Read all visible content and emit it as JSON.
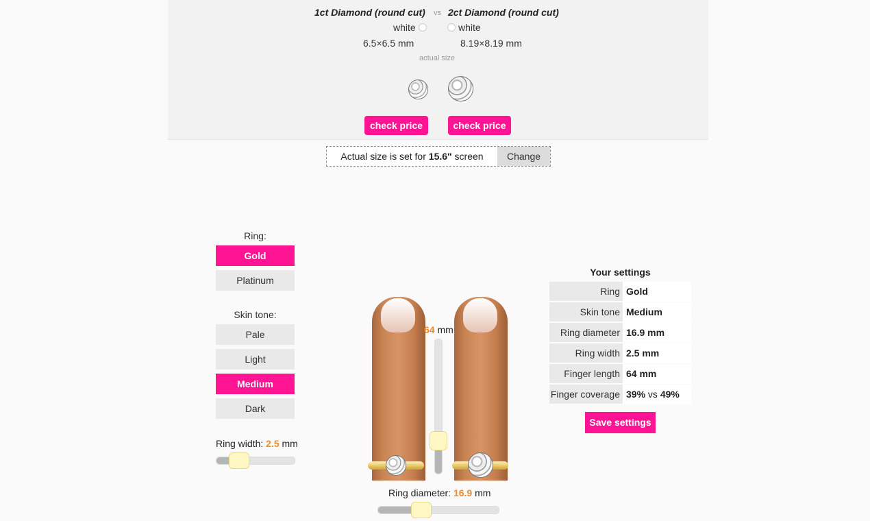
{
  "comparison": {
    "left": {
      "title": "1ct Diamond (round cut)",
      "color": "white",
      "size": "6.5×6.5 mm",
      "button": "check price"
    },
    "vs": "vs",
    "right": {
      "title": "2ct Diamond (round cut)",
      "color": "white",
      "size": "8.19×8.19 mm",
      "button": "check price"
    },
    "actual_size_note": "actual size"
  },
  "screen": {
    "prefix": "Actual size is set for ",
    "size": "15.6\"",
    "suffix": " screen",
    "change": "Change"
  },
  "ring": {
    "label": "Ring:",
    "options": [
      {
        "label": "Gold",
        "active": true
      },
      {
        "label": "Platinum",
        "active": false
      }
    ]
  },
  "skin": {
    "label": "Skin tone:",
    "options": [
      {
        "label": "Pale",
        "active": false
      },
      {
        "label": "Light",
        "active": false
      },
      {
        "label": "Medium",
        "active": true
      },
      {
        "label": "Dark",
        "active": false
      }
    ]
  },
  "ring_width": {
    "label": "Ring width: ",
    "value": "2.5",
    "unit": " mm",
    "fraction": 0.28
  },
  "finger_length": {
    "value": "64",
    "unit": " mm",
    "fraction": 0.25
  },
  "ring_diameter": {
    "label": "Ring diameter: ",
    "value": "16.9",
    "unit": " mm",
    "fraction": 0.35
  },
  "settings": {
    "title": "Your settings",
    "rows": [
      {
        "key": "Ring",
        "value": "Gold"
      },
      {
        "key": "Skin tone",
        "value": "Medium"
      },
      {
        "key": "Ring diameter",
        "value": "16.9 mm"
      },
      {
        "key": "Ring width",
        "value": "2.5 mm"
      },
      {
        "key": "Finger length",
        "value": "64 mm"
      },
      {
        "key": "Finger coverage",
        "value_a": "39%",
        "value_mid": " vs ",
        "value_b": "49%"
      }
    ],
    "save": "Save settings"
  },
  "colors": {
    "accent": "#ff1493",
    "highlight": "#f08a2b"
  }
}
